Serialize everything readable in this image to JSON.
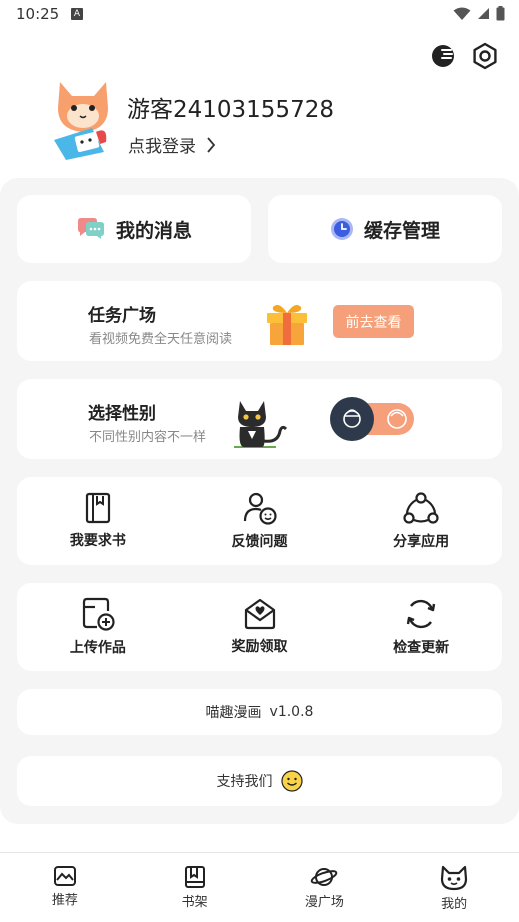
{
  "status_bar": {
    "time": "10:25",
    "a_icon": "A"
  },
  "top_icons": {
    "theme": "night-mode-icon",
    "settings": "settings-icon"
  },
  "profile": {
    "username": "游客24103155728",
    "login_text": "点我登录"
  },
  "quick_actions": {
    "messages": {
      "label": "我的消息",
      "icon": "message-icon"
    },
    "cache": {
      "label": "缓存管理",
      "icon": "clock-icon"
    }
  },
  "task_card": {
    "title": "任务广场",
    "subtitle": "看视频免费全天任意阅读",
    "button": "前去查看"
  },
  "gender_card": {
    "title": "选择性别",
    "subtitle": "不同性别内容不一样"
  },
  "grid_1": [
    {
      "label": "我要求书",
      "icon": "book-icon"
    },
    {
      "label": "反馈问题",
      "icon": "feedback-icon"
    },
    {
      "label": "分享应用",
      "icon": "share-icon"
    }
  ],
  "grid_2": [
    {
      "label": "上传作品",
      "icon": "upload-icon"
    },
    {
      "label": "奖励领取",
      "icon": "reward-icon"
    },
    {
      "label": "检查更新",
      "icon": "refresh-icon"
    }
  ],
  "version": {
    "app_name": "喵趣漫画",
    "version": "v1.0.8"
  },
  "support": {
    "label": "支持我们"
  },
  "tabs": [
    {
      "label": "推荐",
      "icon": "recommend-icon"
    },
    {
      "label": "书架",
      "icon": "bookshelf-icon"
    },
    {
      "label": "漫广场",
      "icon": "planet-icon"
    },
    {
      "label": "我的",
      "icon": "cat-face-icon"
    }
  ],
  "colors": {
    "accent": "#f5a07a",
    "panel": "#f5f5f5"
  }
}
